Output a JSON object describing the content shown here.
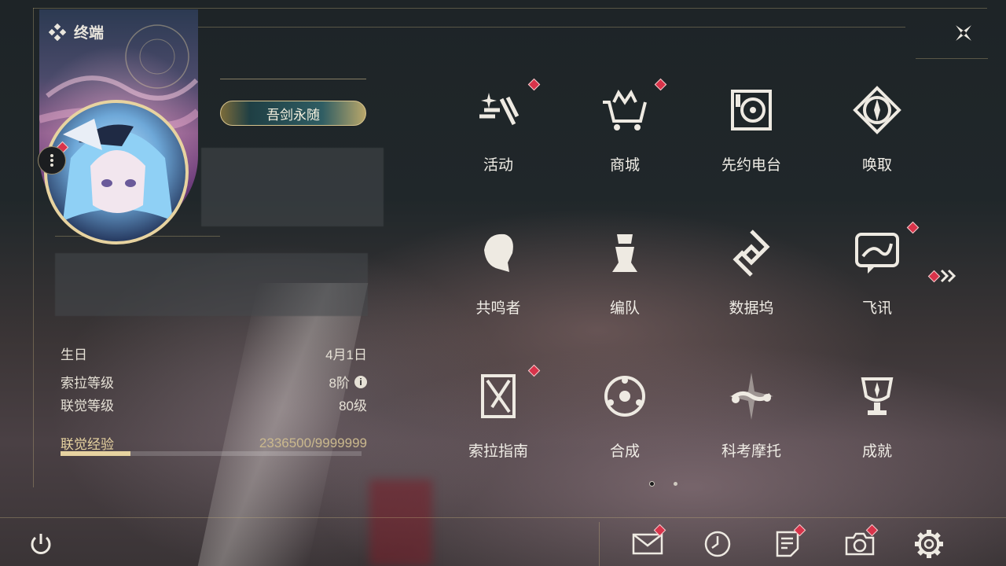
{
  "header": {
    "title": "终端",
    "logo_icon": "terminal-diamond-icon",
    "close_icon": "close-x-icon"
  },
  "profile": {
    "title_plate": "吾剑永随",
    "side_menu_icon": "more-vertical-icon",
    "has_badge": true
  },
  "stats": {
    "birthday_label": "生日",
    "birthday_value": "4月1日",
    "sola_level_label": "索拉等级",
    "sola_level_value": "8阶",
    "union_level_label": "联觉等级",
    "union_level_value": "80级",
    "exp_label": "联觉经验",
    "exp_value": "2336500/9999999",
    "exp_current": 2336500,
    "exp_max": 9999999
  },
  "menu": [
    {
      "label": "活动",
      "icon": "events-icon",
      "badge": true
    },
    {
      "label": "商城",
      "icon": "shop-icon",
      "badge": true
    },
    {
      "label": "先约电台",
      "icon": "radio-icon",
      "badge": false
    },
    {
      "label": "唤取",
      "icon": "convene-icon",
      "badge": false
    },
    {
      "label": "共鸣者",
      "icon": "resonator-icon",
      "badge": false
    },
    {
      "label": "编队",
      "icon": "team-icon",
      "badge": false
    },
    {
      "label": "数据坞",
      "icon": "data-bank-icon",
      "badge": false
    },
    {
      "label": "飞讯",
      "icon": "messenger-icon",
      "badge": true
    },
    {
      "label": "索拉指南",
      "icon": "guidebook-icon",
      "badge": true
    },
    {
      "label": "合成",
      "icon": "synthesis-icon",
      "badge": false
    },
    {
      "label": "科考摩托",
      "icon": "motorbike-icon",
      "badge": false
    },
    {
      "label": "成就",
      "icon": "achievement-icon",
      "badge": false
    }
  ],
  "pagination": {
    "pages": 2,
    "current": 1,
    "next_icon": "double-chevron-right-icon",
    "next_badge": true
  },
  "bottom": {
    "power_icon": "power-icon",
    "mail_icon": "mail-icon",
    "mail_badge": true,
    "clock_icon": "clock-icon",
    "clock_badge": false,
    "notes_icon": "notes-icon",
    "notes_badge": true,
    "camera_icon": "camera-icon",
    "camera_badge": true,
    "settings_icon": "gear-icon",
    "settings_badge": false
  },
  "colors": {
    "accent_gold": "#e7d3a0",
    "badge_red": "#d8334a",
    "text": "#f0ede6"
  }
}
